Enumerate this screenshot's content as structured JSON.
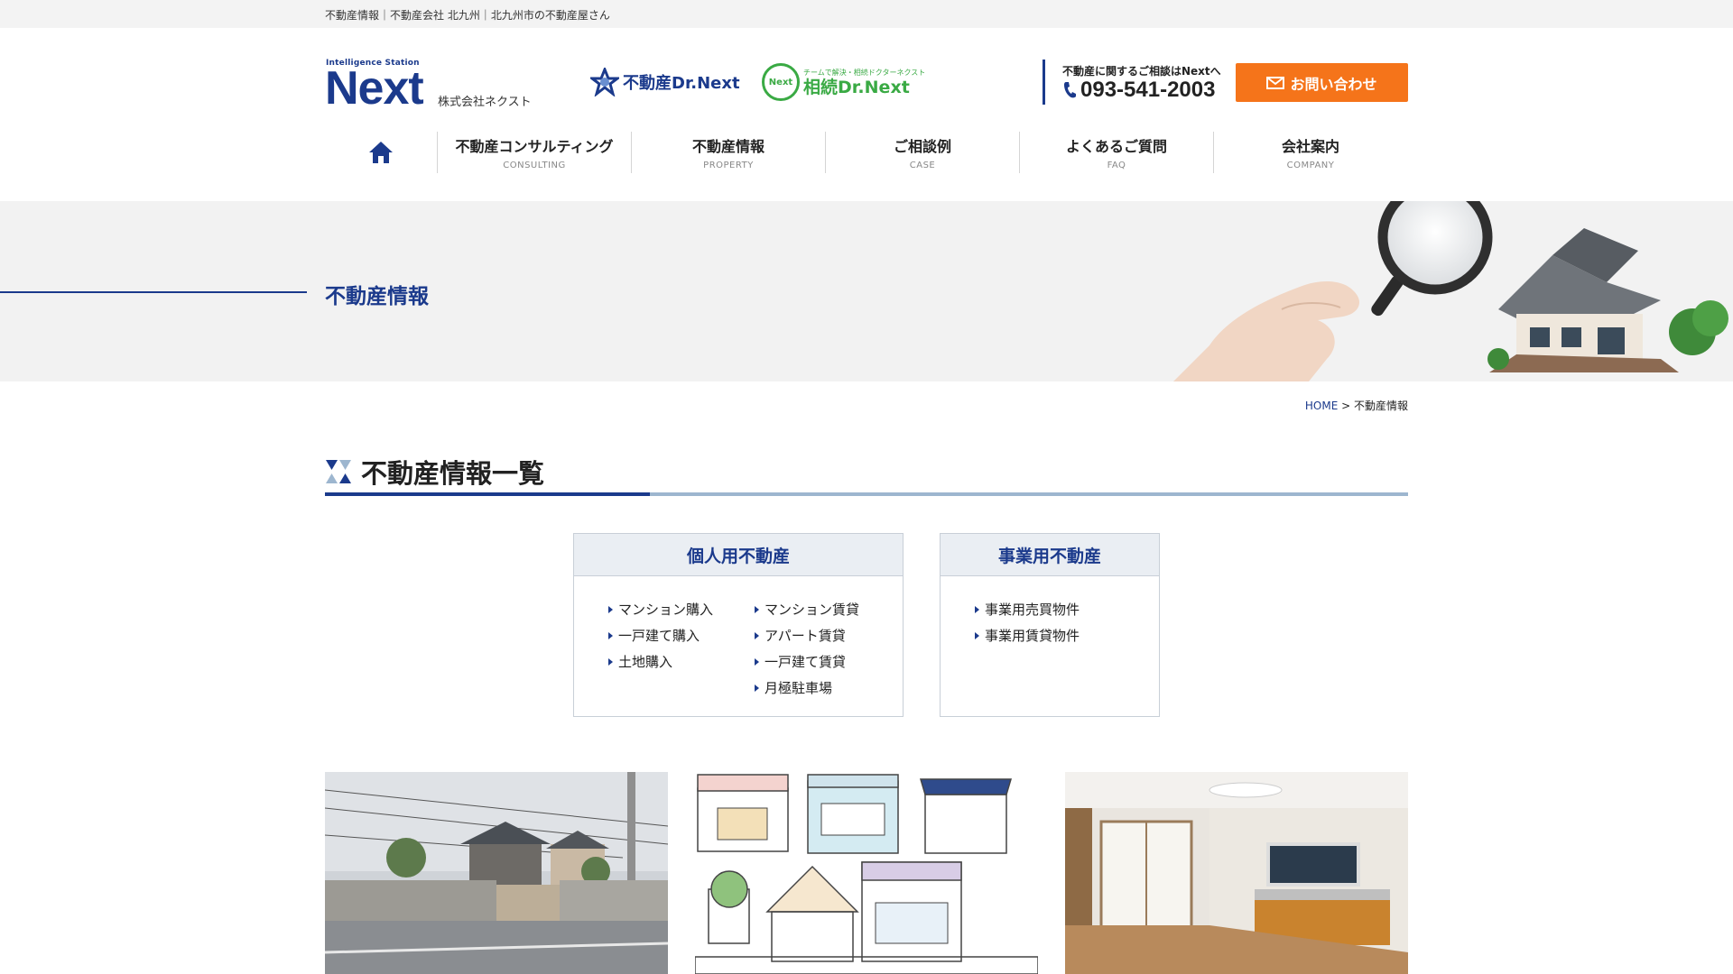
{
  "topbar": {
    "text": "不動産情報｜不動産会社 北九州｜北九州市の不動産屋さん"
  },
  "logo": {
    "tagline": "Intelligence Station",
    "name": "Next",
    "company": "株式会社ネクスト"
  },
  "brands": [
    {
      "name": "不動産Dr.Next"
    },
    {
      "badge": "Next",
      "tagline": "チームで解決・相続ドクターネクスト",
      "name": "相続Dr.Next"
    }
  ],
  "header": {
    "tel_caption": "不動産に関するご相談はNextへ",
    "tel_number": "093-541-2003",
    "contact_label": "お問い合わせ"
  },
  "nav": {
    "items": [
      {
        "label": "不動産コンサルティング",
        "sub": "CONSULTING"
      },
      {
        "label": "不動産情報",
        "sub": "PROPERTY"
      },
      {
        "label": "ご相談例",
        "sub": "CASE"
      },
      {
        "label": "よくあるご質問",
        "sub": "FAQ"
      },
      {
        "label": "会社案内",
        "sub": "COMPANY"
      }
    ]
  },
  "hero": {
    "title": "不動産情報"
  },
  "breadcrumb": {
    "home": "HOME",
    "separator": " > ",
    "current": "不動産情報"
  },
  "section": {
    "title": "不動産情報一覧"
  },
  "categories": {
    "personal": {
      "title": "個人用不動産",
      "col1": [
        "マンション購入",
        "一戸建て購入",
        "土地購入"
      ],
      "col2": [
        "マンション賃貸",
        "アパート賃貸",
        "一戸建て賃貸",
        "月極駐車場"
      ]
    },
    "business": {
      "title": "事業用不動産",
      "col1": [
        "事業用売買物件",
        "事業用賃貸物件"
      ]
    }
  },
  "colors": {
    "brand_navy": "#1b3a8c",
    "accent_orange": "#f5741a",
    "accent_green": "#3aaa44"
  }
}
